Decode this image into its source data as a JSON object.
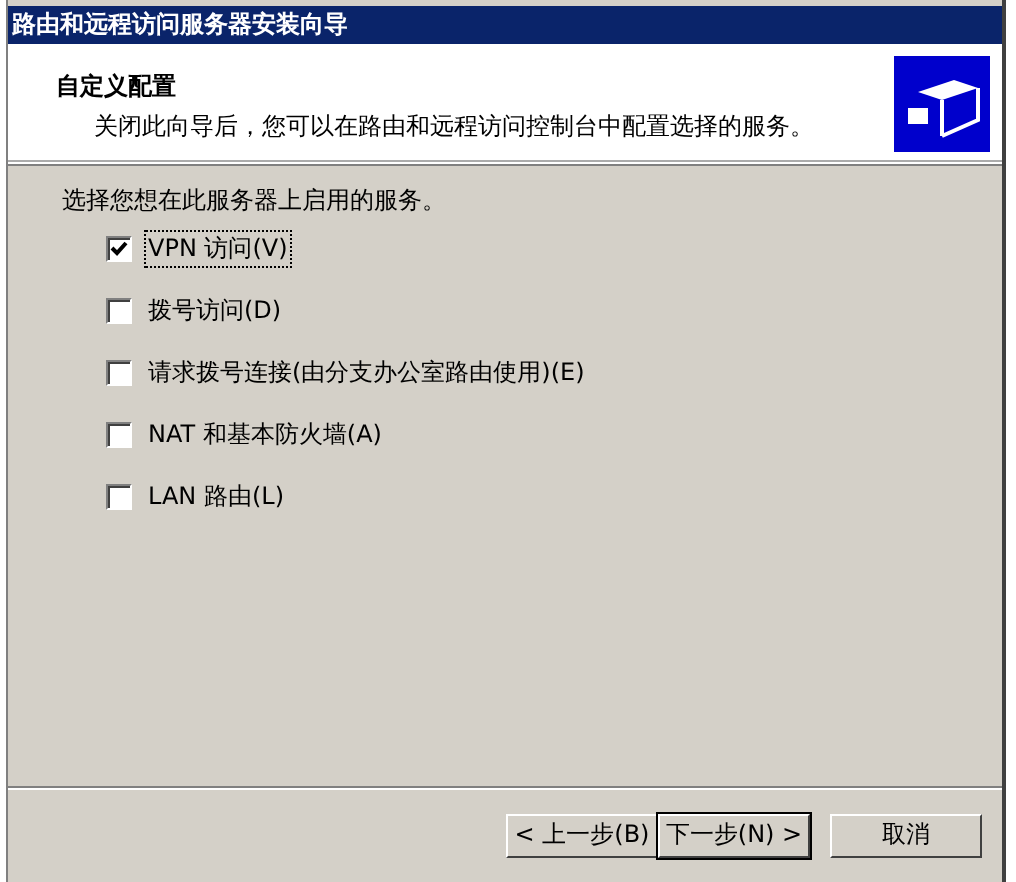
{
  "window": {
    "title": "路由和远程访问服务器安装向导"
  },
  "header": {
    "title": "自定义配置",
    "subtitle": "关闭此向导后，您可以在路由和远程访问控制台中配置选择的服务。"
  },
  "prompt": "选择您想在此服务器上启用的服务。",
  "options": [
    {
      "label": "VPN 访问(V)",
      "checked": true,
      "focused": true
    },
    {
      "label": "拨号访问(D)",
      "checked": false,
      "focused": false
    },
    {
      "label": "请求拨号连接(由分支办公室路由使用)(E)",
      "checked": false,
      "focused": false
    },
    {
      "label": "NAT 和基本防火墙(A)",
      "checked": false,
      "focused": false
    },
    {
      "label": "LAN 路由(L)",
      "checked": false,
      "focused": false
    }
  ],
  "buttons": [
    {
      "label": "< 上一步(B)",
      "default": false
    },
    {
      "label": "下一步(N) >",
      "default": true
    },
    {
      "label": "取消",
      "default": false
    }
  ]
}
